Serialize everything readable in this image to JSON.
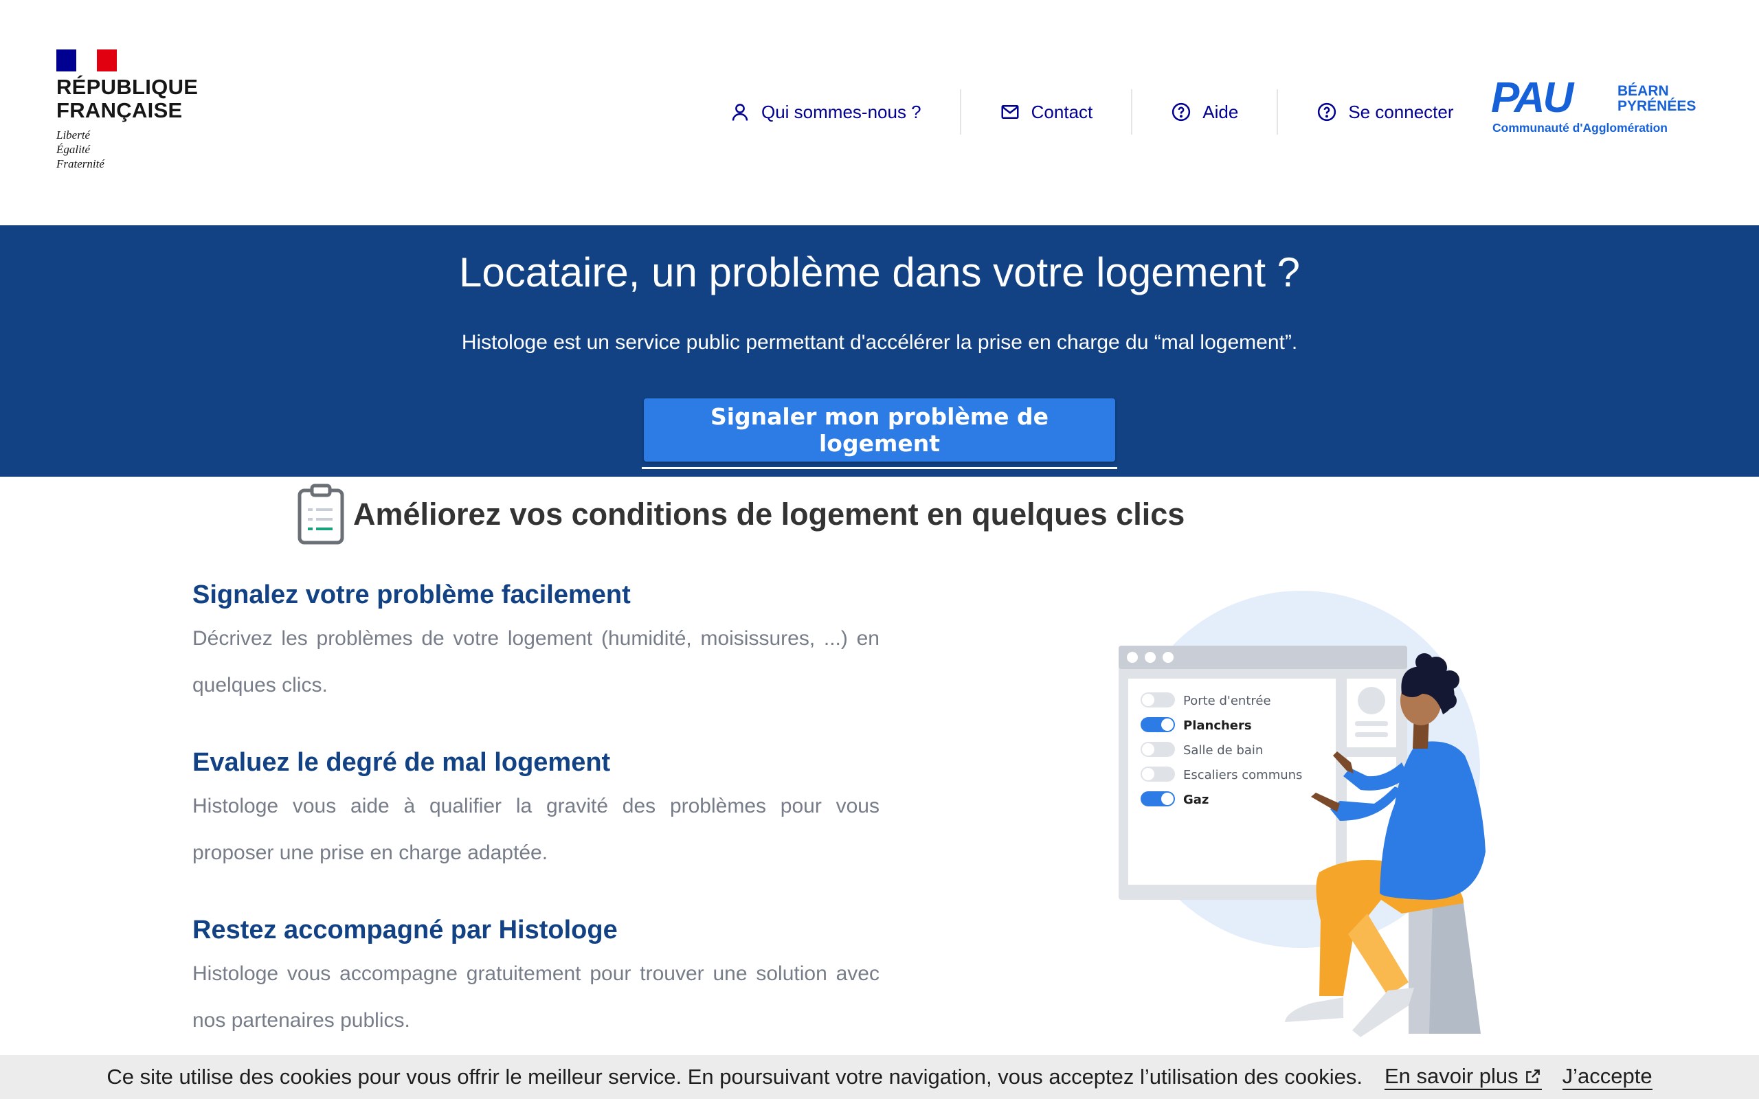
{
  "header": {
    "republic": {
      "line1": "RÉPUBLIQUE",
      "line2": "FRANÇAISE",
      "motto1": "Liberté",
      "motto2": "Égalité",
      "motto3": "Fraternité"
    },
    "nav": [
      {
        "label": "Qui sommes-nous ?",
        "icon": "user-icon"
      },
      {
        "label": "Contact",
        "icon": "mail-icon"
      },
      {
        "label": "Aide",
        "icon": "help-icon"
      },
      {
        "label": "Se connecter",
        "icon": "help-icon"
      }
    ],
    "partner": {
      "word": "PAU",
      "side1": "BÉARN",
      "side2": "PYRÉNÉES",
      "sub": "Communauté d'Agglomération"
    }
  },
  "hero": {
    "title": "Locataire, un problème dans votre logement ?",
    "text": "Histologe est un service public permettant d'accélérer la prise en charge du “mal logement”.",
    "cta": "Signaler mon problème de logement"
  },
  "main": {
    "section_title": "Améliorez vos conditions de logement en quelques clics",
    "features": [
      {
        "title": "Signalez votre problème facilement",
        "text": "Décrivez les problèmes de votre logement (humidité, moisissures, ...) en quelques clics."
      },
      {
        "title": "Evaluez le degré de mal logement",
        "text": "Histologe vous aide à qualifier la gravité des problèmes pour vous proposer une prise en charge adaptée."
      },
      {
        "title": "Restez accompagné par Histologe",
        "text": "Histologe vous accompagne gratuitement pour trouver une solution avec nos partenaires publics."
      }
    ],
    "illustration": {
      "options": [
        {
          "label": "Porte d'entrée",
          "on": false
        },
        {
          "label": "Planchers",
          "on": true
        },
        {
          "label": "Salle de bain",
          "on": false
        },
        {
          "label": "Escaliers communs",
          "on": false
        },
        {
          "label": "Gaz",
          "on": true
        }
      ]
    }
  },
  "cookie": {
    "message": "Ce site utilise des cookies pour vous offrir le meilleur service. En poursuivant votre navigation, vous acceptez l’utilisation des cookies.",
    "more": "En savoir plus",
    "accept": "J’accepte"
  },
  "colors": {
    "brand": "#124284",
    "cta": "#2d7ce5",
    "nav": "#000091",
    "partner": "#1660d8"
  }
}
